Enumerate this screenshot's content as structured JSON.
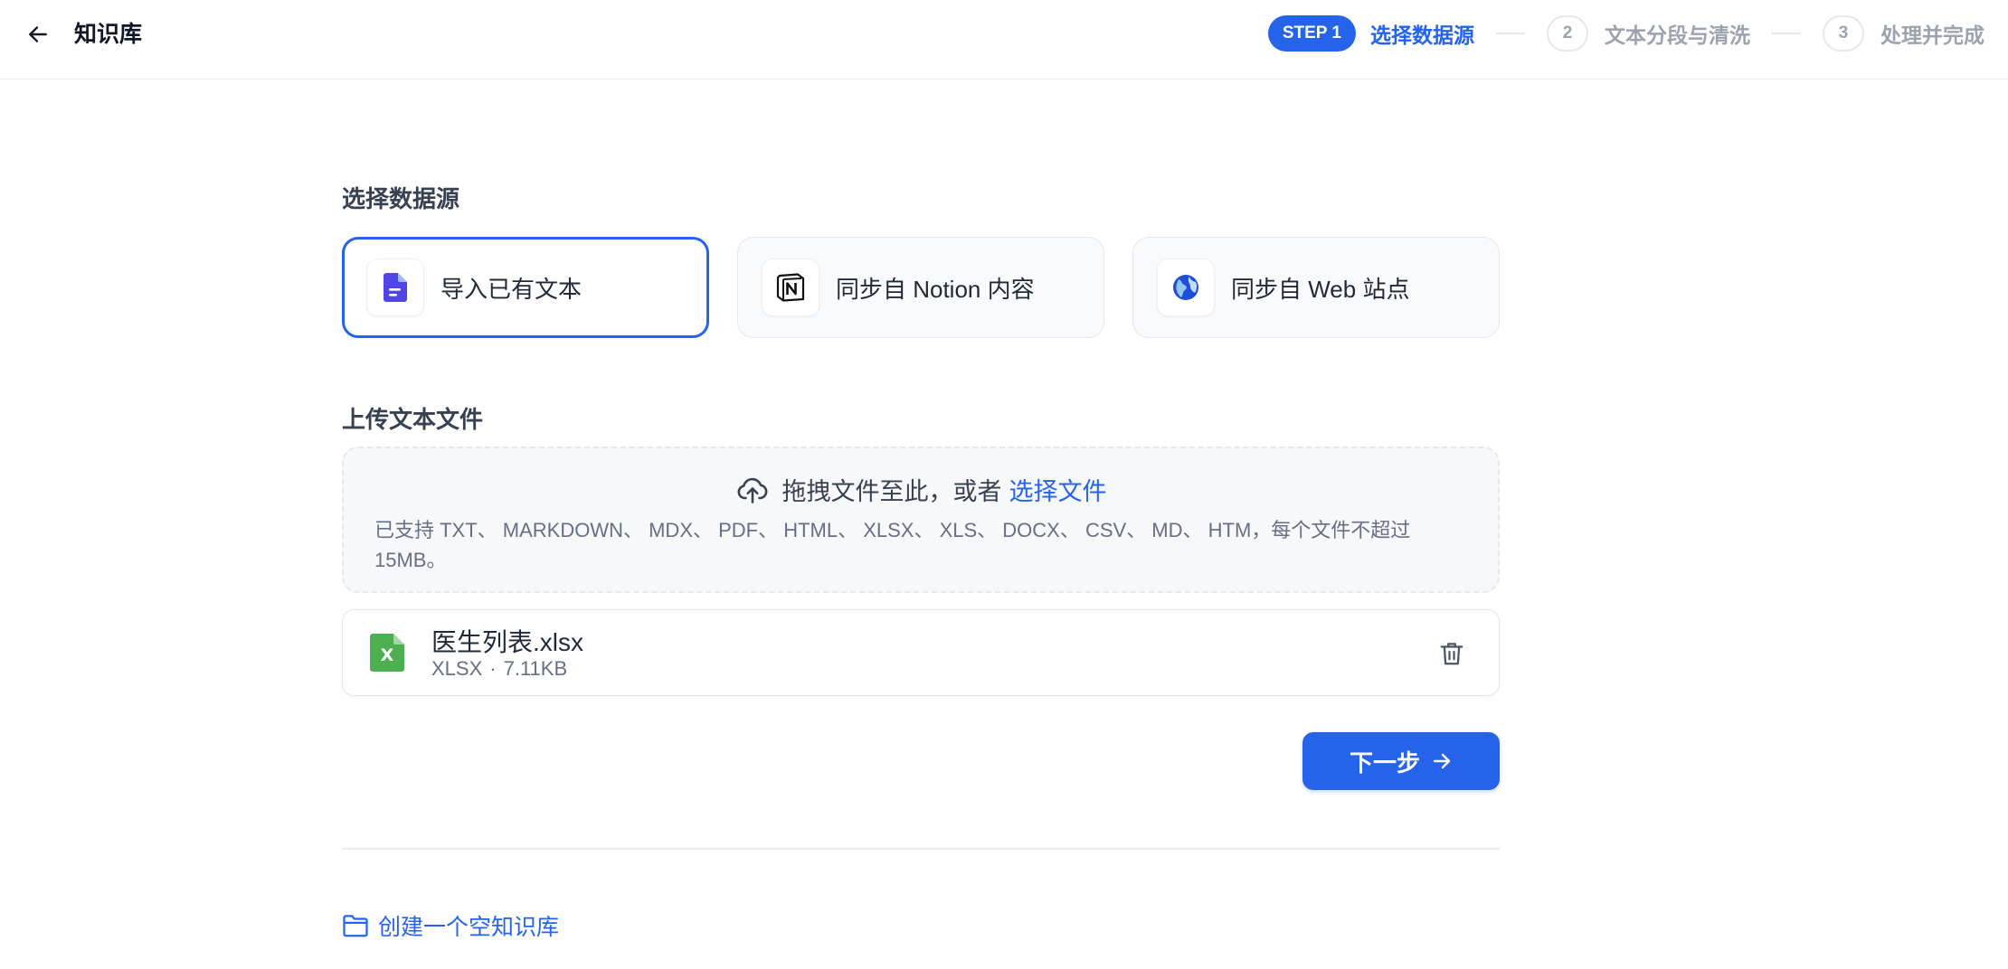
{
  "header": {
    "title": "知识库",
    "steps": {
      "step1_pill": "STEP 1",
      "step1_label": "选择数据源",
      "step2_num": "2",
      "step2_label": "文本分段与清洗",
      "step3_num": "3",
      "step3_label": "处理并完成"
    }
  },
  "data_source": {
    "title": "选择数据源",
    "options": [
      {
        "label": "导入已有文本",
        "icon": "document-icon",
        "selected": true
      },
      {
        "label": "同步自 Notion 内容",
        "icon": "notion-icon",
        "selected": false
      },
      {
        "label": "同步自 Web 站点",
        "icon": "globe-icon",
        "selected": false
      }
    ]
  },
  "upload": {
    "title": "上传文本文件",
    "drop_text": "拖拽文件至此，或者",
    "choose_link": "选择文件",
    "hint": "已支持 TXT、 MARKDOWN、 MDX、 PDF、 HTML、 XLSX、 XLS、 DOCX、 CSV、 MD、 HTM，每个文件不超过 15MB。"
  },
  "file": {
    "name": "医生列表.xlsx",
    "type": "XLSX",
    "separator": "·",
    "size": "7.11KB",
    "icon_letter": "X"
  },
  "actions": {
    "next_label": "下一步",
    "create_empty_label": "创建一个空知识库"
  },
  "colors": {
    "accent": "#2563eb",
    "excel_green": "#4caf50"
  }
}
